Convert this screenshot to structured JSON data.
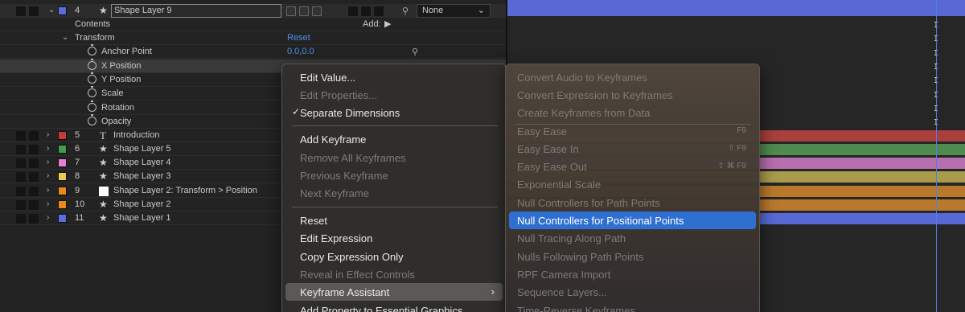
{
  "layers": [
    {
      "num": "4",
      "name": "Shape Layer 9",
      "label_color": "#5b6ee0",
      "type_icon": "star-icon",
      "parent": "None"
    },
    {
      "num": "5",
      "name": "Introduction",
      "label_color": "#c23a3a",
      "type_icon": "text-icon"
    },
    {
      "num": "6",
      "name": "Shape Layer 5",
      "label_color": "#3f9e4a",
      "type_icon": "star-icon"
    },
    {
      "num": "7",
      "name": "Shape Layer 4",
      "label_color": "#e67fd6",
      "type_icon": "star-icon"
    },
    {
      "num": "8",
      "name": "Shape Layer 3",
      "label_color": "#e6cf4a",
      "type_icon": "star-icon"
    },
    {
      "num": "9",
      "name": "Shape Layer 2: Transform > Position",
      "label_color": "#e88a1a",
      "type_icon": "solid-icon"
    },
    {
      "num": "10",
      "name": "Shape Layer 2",
      "label_color": "#e88a1a",
      "type_icon": "star-icon"
    },
    {
      "num": "11",
      "name": "Shape Layer 1",
      "label_color": "#5b6ee0",
      "type_icon": "star-icon"
    }
  ],
  "contents": {
    "label": "Contents",
    "add_label": "Add:"
  },
  "transform": {
    "label": "Transform",
    "reset": "Reset"
  },
  "properties": {
    "anchor_point": {
      "label": "Anchor Point",
      "value": "0.0,0.0"
    },
    "x_position": {
      "label": "X Position"
    },
    "y_position": {
      "label": "Y Position"
    },
    "scale": {
      "label": "Scale"
    },
    "rotation": {
      "label": "Rotation"
    },
    "opacity": {
      "label": "Opacity"
    }
  },
  "main_menu": {
    "items": [
      {
        "label": "Edit Value...",
        "enabled": true
      },
      {
        "label": "Edit Properties...",
        "enabled": false
      },
      {
        "label": "Separate Dimensions",
        "enabled": true,
        "checked": true
      },
      {
        "label": "Add Keyframe",
        "enabled": true
      },
      {
        "label": "Remove All Keyframes",
        "enabled": false
      },
      {
        "label": "Previous Keyframe",
        "enabled": false
      },
      {
        "label": "Next Keyframe",
        "enabled": false
      },
      {
        "label": "Reset",
        "enabled": true
      },
      {
        "label": "Edit Expression",
        "enabled": true
      },
      {
        "label": "Copy Expression Only",
        "enabled": true
      },
      {
        "label": "Reveal in Effect Controls",
        "enabled": false
      },
      {
        "label": "Keyframe Assistant",
        "enabled": true,
        "submenu": true
      },
      {
        "label": "Add Property to Essential Graphics",
        "enabled": true
      }
    ]
  },
  "sub_menu": {
    "items": [
      {
        "label": "Convert Audio to Keyframes",
        "enabled": false
      },
      {
        "label": "Convert Expression to Keyframes",
        "enabled": false
      },
      {
        "label": "Create Keyframes from Data",
        "enabled": false
      },
      {
        "label": "Easy Ease",
        "enabled": false,
        "shortcut": "F9"
      },
      {
        "label": "Easy Ease In",
        "enabled": false,
        "shortcut": "⇧ F9"
      },
      {
        "label": "Easy Ease Out",
        "enabled": false,
        "shortcut": "⇧ ⌘ F9"
      },
      {
        "label": "Exponential Scale",
        "enabled": false
      },
      {
        "label": "Null Controllers for Path Points",
        "enabled": false
      },
      {
        "label": "Null Controllers for Positional Points",
        "enabled": true,
        "highlighted": true
      },
      {
        "label": "Null Tracing Along Path",
        "enabled": false
      },
      {
        "label": "Nulls Following Path Points",
        "enabled": false
      },
      {
        "label": "RPF Camera Import",
        "enabled": false
      },
      {
        "label": "Sequence Layers...",
        "enabled": false
      },
      {
        "label": "Time-Reverse Keyframes",
        "enabled": false
      }
    ]
  },
  "colors": {
    "accent": "#2f6fd1",
    "playhead": "#4d7fe8"
  }
}
